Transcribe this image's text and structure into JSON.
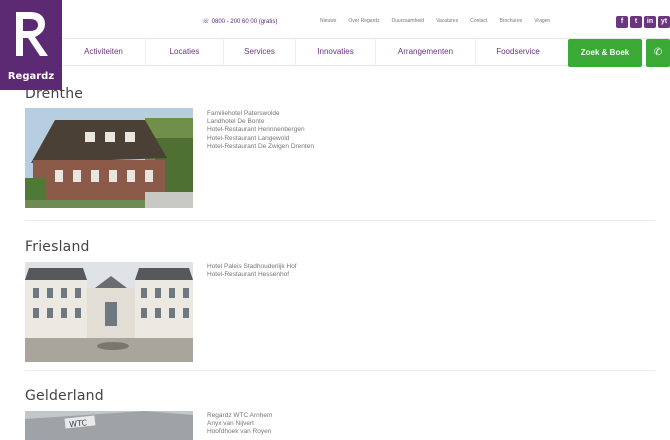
{
  "brand": {
    "name": "Regardz",
    "accent": "#5c2a72",
    "green": "#3aa935"
  },
  "topbar": {
    "phone": "0800 - 200 60 00",
    "phone_extra": "(gratis)",
    "links": [
      "Nieuws",
      "Over Regardz",
      "Duurzaamheid",
      "Vacatures",
      "Contact",
      "Brochures",
      "Vragen"
    ],
    "socials": [
      "f",
      "t",
      "in",
      "yt"
    ]
  },
  "nav": {
    "items": [
      "Activiteiten",
      "Locaties",
      "Services",
      "Innovaties",
      "Arrangementen",
      "Foodservice"
    ],
    "zoek_label": "Zoek & Boek",
    "call_icon": "phone-icon"
  },
  "sections": [
    {
      "title": "Drenthe",
      "items": [
        "Familiehotel Paterswolde",
        "Landhotel De Bonte",
        "Hotel-Restaurant Herinnenbergen",
        "Hotel-Restaurant Langewold",
        "Hotel-Restaurant De Zwigen Drenten"
      ]
    },
    {
      "title": "Friesland",
      "items": [
        "Hotel Paleis Stadhouderlijk Hof",
        "Hotel-Restaurant Hessenhof"
      ]
    },
    {
      "title": "Gelderland",
      "items": [
        "Regardz WTC Arnhem",
        "Anyx van Nijvert",
        "Hoofdhoek van Royen"
      ]
    }
  ]
}
